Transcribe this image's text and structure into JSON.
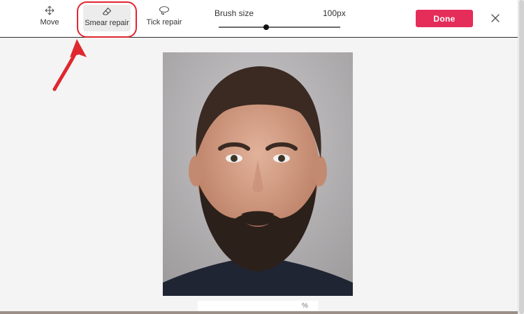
{
  "toolbar": {
    "tools": [
      {
        "label": "Move",
        "icon": "move-arrows-icon",
        "active": false
      },
      {
        "label": "Smear repair",
        "icon": "eraser-icon",
        "active": true
      },
      {
        "label": "Tick repair",
        "icon": "lasso-icon",
        "active": false
      }
    ],
    "brush": {
      "label": "Brush size",
      "value_text": "100px",
      "level": 0.39
    },
    "done_label": "Done",
    "close_icon": "close-icon"
  },
  "canvas": {
    "image_subject": "portrait photo of bearded man",
    "bottom_value": "%"
  },
  "colors": {
    "accent": "#e52d5a",
    "highlight": "#e0272f"
  }
}
